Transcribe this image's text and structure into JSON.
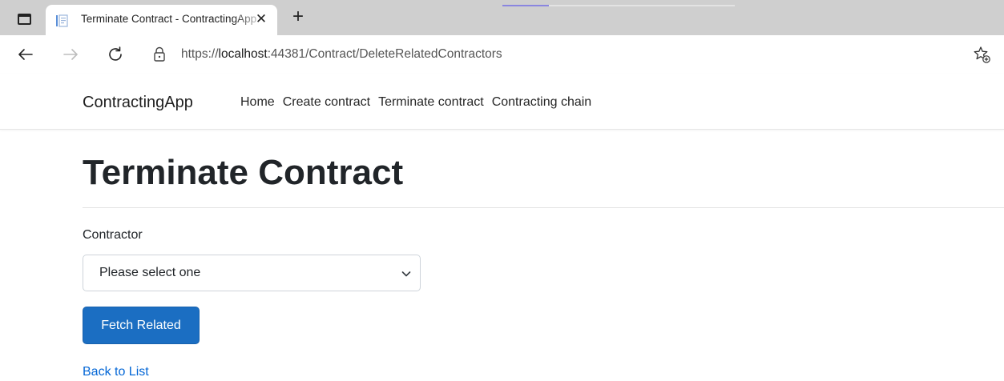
{
  "browser": {
    "tab_title": "Terminate Contract - ContractingApp",
    "tab_close_glyph": "✕",
    "new_tab_glyph": "+",
    "url_prefix": "https://",
    "url_host": "localhost",
    "url_rest": ":44381/Contract/DeleteRelatedContractors",
    "icons": [
      "window-icon",
      "favicon-icon",
      "close-icon",
      "plus-icon",
      "back-arrow-icon",
      "forward-arrow-icon",
      "refresh-icon",
      "lock-icon",
      "favorite-star-icon"
    ]
  },
  "navbar": {
    "brand": "ContractingApp",
    "links": [
      "Home",
      "Create contract",
      "Terminate contract",
      "Contracting chain"
    ]
  },
  "main": {
    "title": "Terminate Contract",
    "contractor_label": "Contractor",
    "contractor_select": {
      "selected": "Please select one"
    },
    "fetch_button": "Fetch Related",
    "back_link": "Back to List"
  },
  "colors": {
    "primary": "#1b6ec2",
    "link": "#0366d6",
    "text": "#212529"
  }
}
